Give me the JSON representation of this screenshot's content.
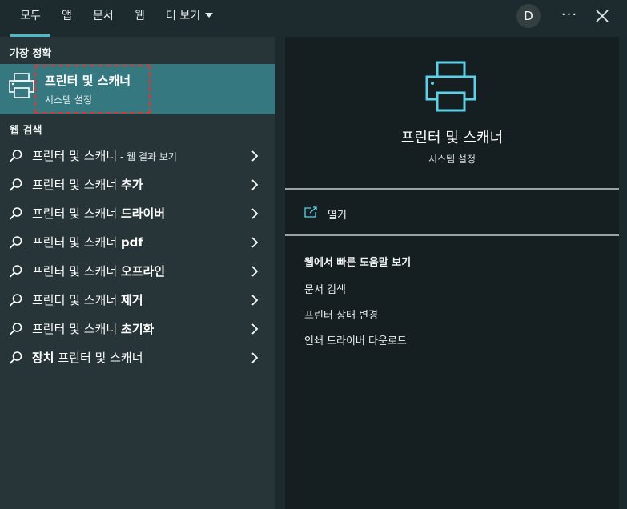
{
  "tabs": {
    "all": "모두",
    "apps": "앱",
    "documents": "문서",
    "web": "웹",
    "more": "더 보기"
  },
  "avatar_initial": "D",
  "more_options": "···",
  "best_match": {
    "header": "가장 정확",
    "title": "프린터 및 스캐너",
    "subtitle": "시스템 설정"
  },
  "web_search": {
    "header": "웹 검색",
    "rows": [
      {
        "plain": "프린터 및 스캐너",
        "bold": "",
        "suffix": " - 웹 결과 보기"
      },
      {
        "plain": "프린터 및 스캐너 ",
        "bold": "추가",
        "suffix": ""
      },
      {
        "plain": "프린터 및 스캐너 ",
        "bold": "드라이버",
        "suffix": ""
      },
      {
        "plain": "프린터 및 스캐너 ",
        "bold": "pdf",
        "suffix": ""
      },
      {
        "plain": "프린터 및 스캐너 ",
        "bold": "오프라인",
        "suffix": ""
      },
      {
        "plain": "프린터 및 스캐너 ",
        "bold": "제거",
        "suffix": ""
      },
      {
        "plain": "프린터 및 스캐너 ",
        "bold": "초기화",
        "suffix": ""
      },
      {
        "bold_first": "장치",
        "plain": " 프린터 및 스캐너"
      }
    ]
  },
  "detail": {
    "title": "프린터 및 스캐너",
    "subtitle": "시스템 설정",
    "open_label": "열기",
    "help_title": "웹에서 빠른 도움말 보기",
    "help_links": [
      "문서 검색",
      "프린터 상태 변경",
      "인쇄 드라이버 다운로드"
    ]
  },
  "colors": {
    "accent": "#4db8cc",
    "selected_bg": "#36787f",
    "highlight_border": "#d43a3a",
    "left_bg": "#273538",
    "right_bg": "#151e21"
  }
}
